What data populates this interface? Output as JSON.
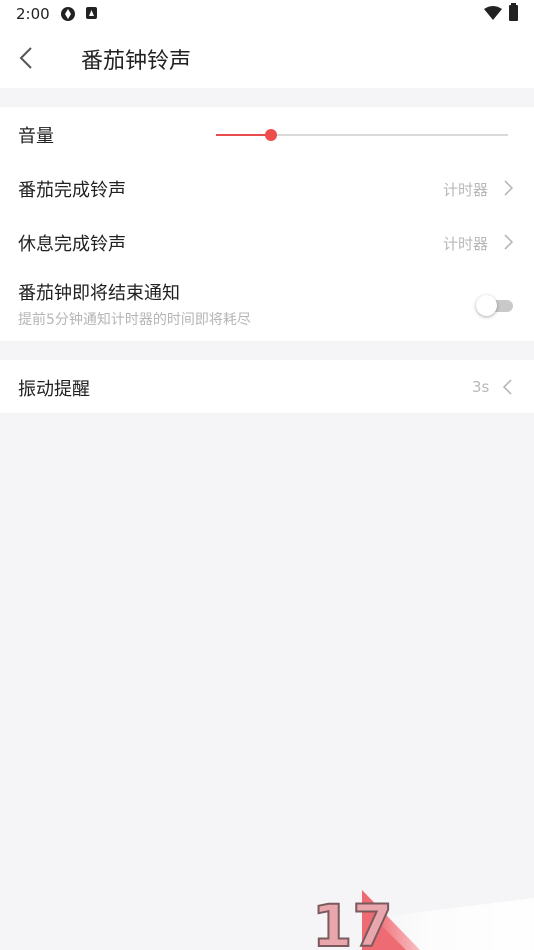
{
  "status_bar": {
    "time": "2:00"
  },
  "app_bar": {
    "title": "番茄钟铃声"
  },
  "settings": {
    "volume": {
      "label": "音量",
      "level_fraction": 0.19
    },
    "tomato_ringtone": {
      "label": "番茄完成铃声",
      "value": "计时器"
    },
    "rest_ringtone": {
      "label": "休息完成铃声",
      "value": "计时器"
    },
    "ending_notice": {
      "label": "番茄钟即将结束通知",
      "description": "提前5分钟通知计时器的时间即将耗尽",
      "enabled": false
    },
    "vibration": {
      "label": "振动提醒",
      "value": "3s"
    }
  },
  "watermark": {
    "text": "17"
  },
  "colors": {
    "accent": "#ef4c4c",
    "background": "#f5f5f7",
    "card": "#ffffff",
    "secondary_text": "#b8b8b8"
  },
  "icons": [
    "back-arrow-icon",
    "chevron-right-icon",
    "chevron-left-icon",
    "wifi-icon",
    "battery-icon"
  ]
}
